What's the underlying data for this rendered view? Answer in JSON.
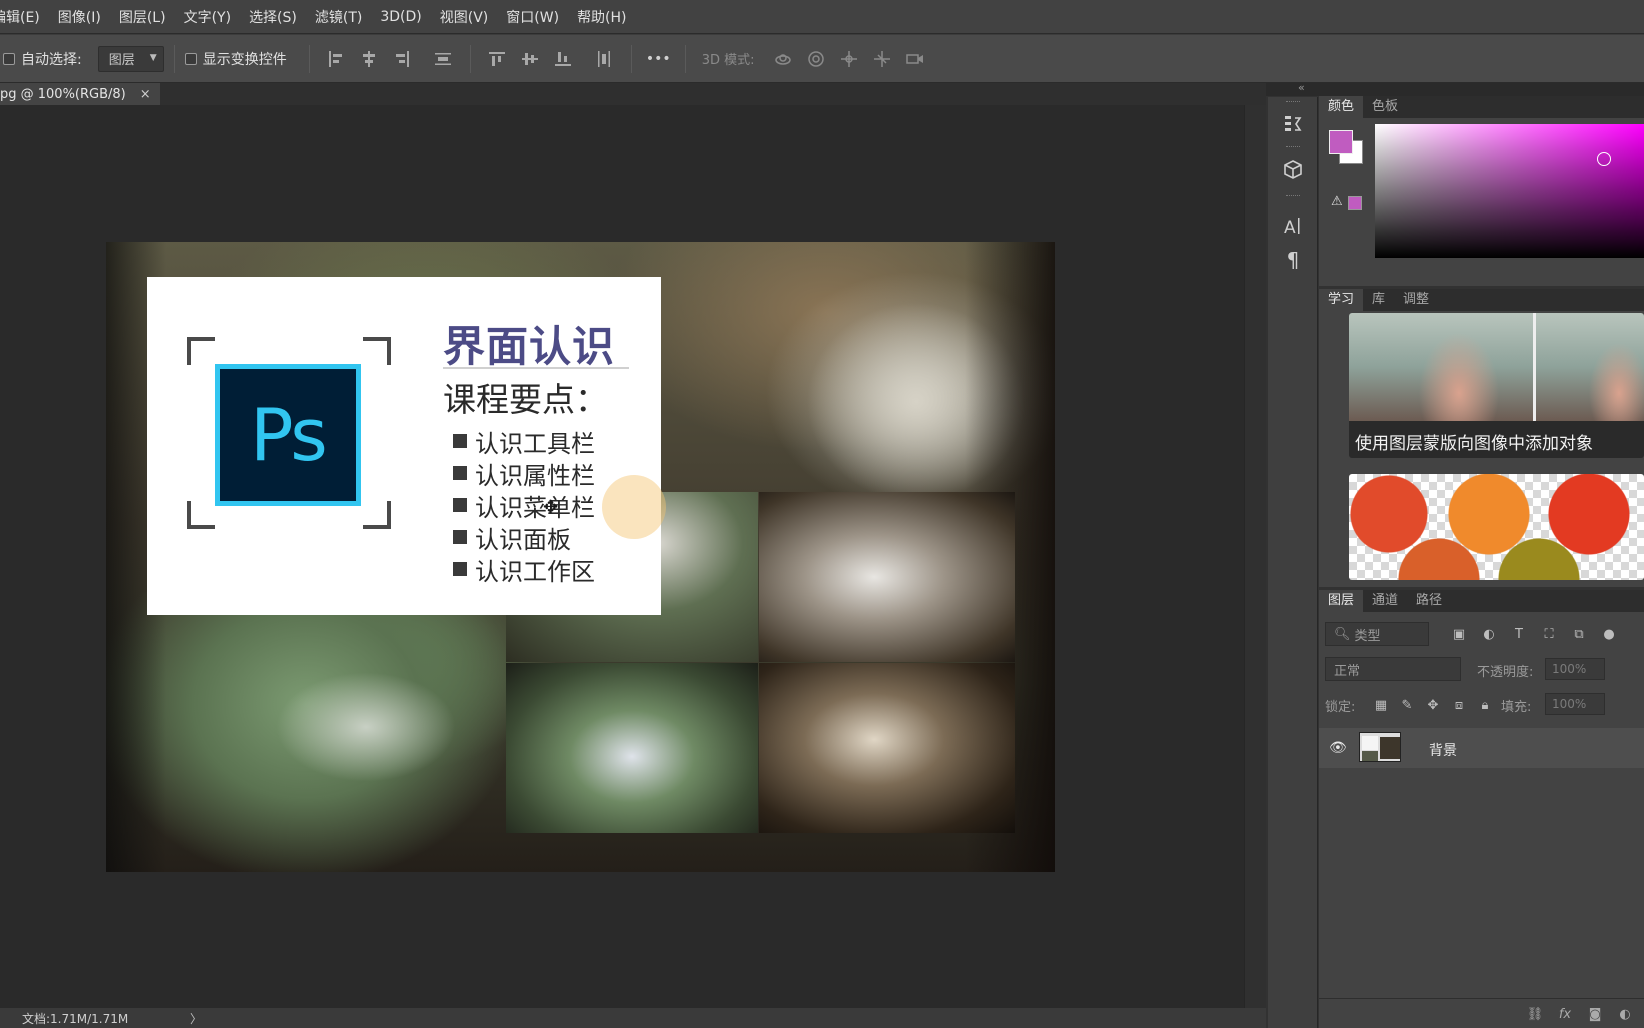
{
  "menu": {
    "items": [
      "编辑(E)",
      "图像(I)",
      "图层(L)",
      "文字(Y)",
      "选择(S)",
      "滤镜(T)",
      "3D(D)",
      "视图(V)",
      "窗口(W)",
      "帮助(H)"
    ]
  },
  "options": {
    "auto_select_label": "自动选择:",
    "auto_select_value": "图层",
    "show_transform_label": "显示变换控件",
    "more_label": "•••",
    "mode3d_label": "3D 模式:"
  },
  "document": {
    "tab_label": "pg @ 100%(RGB/8)",
    "close": "×",
    "status": "文档:1.71M/1.71M",
    "status_arrow": "〉"
  },
  "artwork": {
    "logo_text": "Ps",
    "title": "界面认识",
    "subtitle": "课程要点：",
    "list": [
      "认识工具栏",
      "认识属性栏",
      "认识菜单栏",
      "认识面板",
      "认识工作区"
    ]
  },
  "color_panel": {
    "tabs": [
      "颜色",
      "色板"
    ],
    "foreground": "#c05cc0",
    "background": "#ffffff",
    "warn": "⚠"
  },
  "learn_panel": {
    "tabs": [
      "学习",
      "库",
      "调整"
    ],
    "card1_caption": "使用图层蒙版向图像中添加对象"
  },
  "layers_panel": {
    "tabs": [
      "图层",
      "通道",
      "路径"
    ],
    "filter_placeholder": "类型",
    "blend_mode": "正常",
    "opacity_label": "不透明度:",
    "opacity_value": "100%",
    "lock_label": "锁定:",
    "fill_label": "填充:",
    "fill_value": "100%",
    "layers": [
      {
        "name": "背景",
        "visible": true
      }
    ]
  },
  "icons": {
    "eye": "eye-icon",
    "expand": "«"
  }
}
